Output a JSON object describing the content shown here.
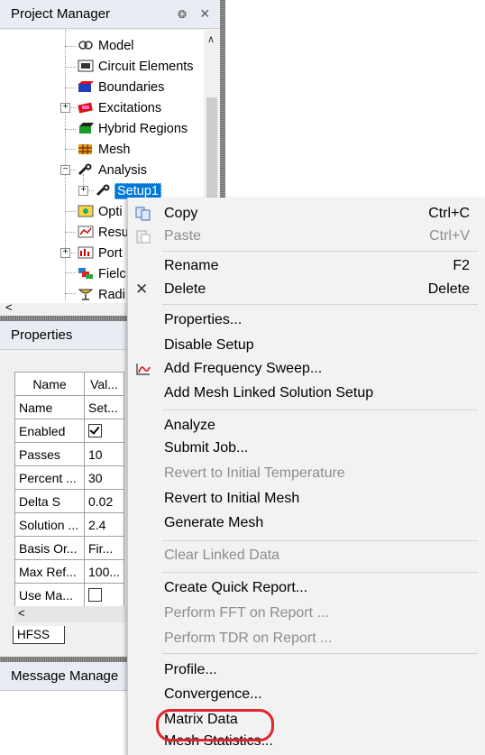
{
  "project_manager": {
    "title": "Project Manager",
    "pin_glyph": "❂",
    "close_glyph": "×",
    "tree": [
      {
        "label": "Model",
        "icon": "model-icon"
      },
      {
        "label": "Circuit Elements",
        "icon": "circuit-elements-icon"
      },
      {
        "label": "Boundaries",
        "icon": "boundaries-icon"
      },
      {
        "label": "Excitations",
        "icon": "excitations-icon"
      },
      {
        "label": "Hybrid Regions",
        "icon": "hybrid-regions-icon"
      },
      {
        "label": "Mesh",
        "icon": "mesh-icon"
      },
      {
        "label": "Analysis",
        "icon": "analysis-icon"
      },
      {
        "label": "Setup1",
        "icon": "setup-icon"
      },
      {
        "label": "Opti",
        "icon": "optimetrics-icon"
      },
      {
        "label": "Resu",
        "icon": "results-icon"
      },
      {
        "label": "Port",
        "icon": "port-icon"
      },
      {
        "label": "Fielc",
        "icon": "field-overlays-icon"
      },
      {
        "label": "Radi",
        "icon": "radiation-icon"
      }
    ],
    "scroll_left_glyph": "<"
  },
  "properties": {
    "title": "Properties",
    "columns": [
      "Name",
      "Val..."
    ],
    "rows": [
      {
        "name": "Name",
        "value": "Set..."
      },
      {
        "name": "Enabled",
        "value": "",
        "checked": true
      },
      {
        "name": "Passes",
        "value": "10"
      },
      {
        "name": "Percent ...",
        "value": "30"
      },
      {
        "name": "Delta S",
        "value": "0.02"
      },
      {
        "name": "Solution ...",
        "value": "2.4"
      },
      {
        "name": "Basis Or...",
        "value": "Fir..."
      },
      {
        "name": "Max Ref...",
        "value": "100..."
      },
      {
        "name": "Use Ma...",
        "value": "",
        "checked": false
      }
    ],
    "scroll_left_glyph": "<",
    "tab_label": "HFSS"
  },
  "message_manager": {
    "title": "Message Manage"
  },
  "context_menu": {
    "items": [
      {
        "label": "Copy",
        "shortcut": "Ctrl+C",
        "disabled": false,
        "icon": "copy-icon"
      },
      {
        "label": "Paste",
        "shortcut": "Ctrl+V",
        "disabled": true,
        "icon": "paste-icon"
      },
      {
        "label": "Rename",
        "shortcut": "F2",
        "disabled": false
      },
      {
        "label": "Delete",
        "shortcut": "Delete",
        "disabled": false,
        "icon": "delete-icon"
      },
      {
        "label": "Properties...",
        "disabled": false
      },
      {
        "label": "Disable Setup",
        "disabled": false
      },
      {
        "label": "Add Frequency Sweep...",
        "disabled": false,
        "icon": "frequency-sweep-icon"
      },
      {
        "label": "Add Mesh Linked Solution Setup",
        "disabled": false
      },
      {
        "label": "Analyze",
        "disabled": false
      },
      {
        "label": "Submit Job...",
        "disabled": false
      },
      {
        "label": "Revert to Initial Temperature",
        "disabled": true
      },
      {
        "label": "Revert to Initial Mesh",
        "disabled": false
      },
      {
        "label": "Generate Mesh",
        "disabled": false
      },
      {
        "label": "Clear Linked Data",
        "disabled": true
      },
      {
        "label": "Create Quick Report...",
        "disabled": false
      },
      {
        "label": "Perform FFT on Report ...",
        "disabled": true
      },
      {
        "label": "Perform TDR on Report ...",
        "disabled": true
      },
      {
        "label": "Profile...",
        "disabled": false
      },
      {
        "label": "Convergence...",
        "disabled": false
      },
      {
        "label": "Matrix Data",
        "disabled": false,
        "highlighted": true
      },
      {
        "label": "Mesh Statistics...",
        "disabled": false
      }
    ],
    "delete_glyph": "✕"
  },
  "colors": {
    "selection": "#0078d7",
    "highlight_oval": "#e0252b",
    "disabled_text": "#8d8d8d"
  }
}
